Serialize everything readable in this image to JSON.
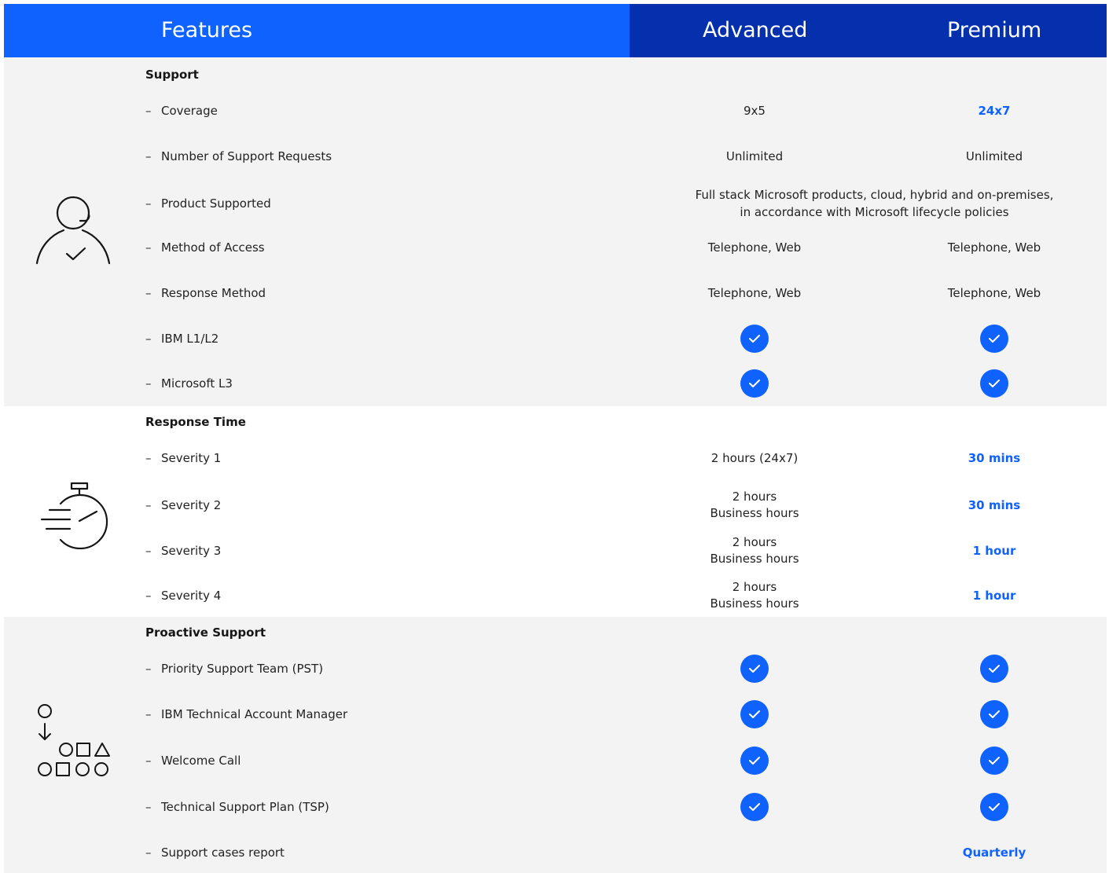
{
  "header": {
    "features_label": "Features",
    "advanced_label": "Advanced",
    "premium_label": "Premium"
  },
  "colors": {
    "features_header_bg": "#0f62fe",
    "plans_header_bg": "#0530ad",
    "accent_blue": "#0f62fe",
    "section_gray_bg": "#f3f3f3"
  },
  "sections": [
    {
      "title": "Support",
      "icon": "support-agent-icon",
      "rows": [
        {
          "label": "Coverage",
          "advanced": "9x5",
          "premium": "24x7"
        },
        {
          "label": "Number of Support Requests",
          "advanced": "Unlimited",
          "premium": "Unlimited"
        },
        {
          "label": "Product Supported",
          "both_line1": "Full stack Microsoft products, cloud, hybrid and on-premises,",
          "both_line2": "in accordance with Microsoft lifecycle policies"
        },
        {
          "label": "Method of Access",
          "advanced": "Telephone, Web",
          "premium": "Telephone, Web"
        },
        {
          "label": "Response Method",
          "advanced": "Telephone, Web",
          "premium": "Telephone, Web"
        },
        {
          "label": "IBM L1/L2",
          "advanced_check": "check-icon",
          "premium_check": "check-icon"
        },
        {
          "label": "Microsoft L3",
          "advanced_check": "check-icon",
          "premium_check": "check-icon"
        }
      ]
    },
    {
      "title": "Response Time",
      "icon": "stopwatch-icon",
      "rows": [
        {
          "label": "Severity 1",
          "advanced": "2 hours (24x7)",
          "premium": "30 mins"
        },
        {
          "label": "Severity 2",
          "advanced_line1": "2 hours",
          "advanced_line2": "Business hours",
          "premium": "30 mins"
        },
        {
          "label": "Severity 3",
          "advanced_line1": "2 hours",
          "advanced_line2": "Business hours",
          "premium": "1 hour"
        },
        {
          "label": "Severity 4",
          "advanced_line1": "2 hours",
          "advanced_line2": "Business hours",
          "premium": "1 hour"
        }
      ]
    },
    {
      "title": "Proactive Support",
      "icon": "workflow-shapes-icon",
      "rows": [
        {
          "label": "Priority Support Team (PST)",
          "advanced_check": "check-icon",
          "premium_check": "check-icon"
        },
        {
          "label": "IBM Technical Account Manager",
          "advanced_check": "check-icon",
          "premium_check": "check-icon"
        },
        {
          "label": "Welcome Call",
          "advanced_check": "check-icon",
          "premium_check": "check-icon"
        },
        {
          "label": "Technical Support Plan (TSP)",
          "advanced_check": "check-icon",
          "premium_check": "check-icon"
        },
        {
          "label": "Support cases report",
          "advanced": "",
          "premium": "Quarterly"
        }
      ]
    }
  ],
  "dash": "–"
}
